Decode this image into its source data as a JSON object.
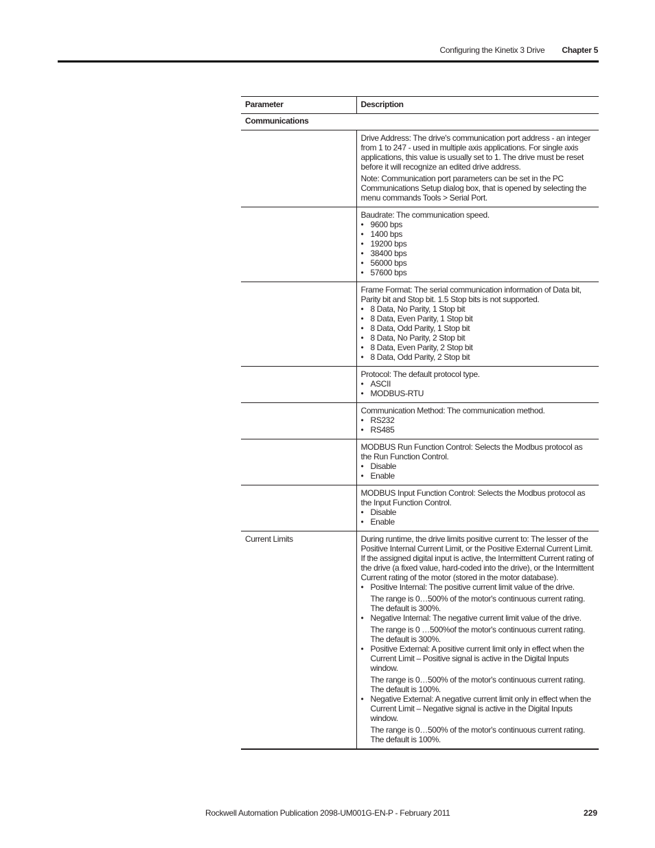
{
  "header": {
    "section_title": "Configuring the Kinetix 3 Drive",
    "chapter": "Chapter 5"
  },
  "table": {
    "columns": [
      "Parameter",
      "Description"
    ],
    "group": "Communications",
    "rows": [
      {
        "parameter": "",
        "paragraphs": [
          "Drive Address: The drive's communication port address - an integer from 1 to 247 - used in multiple axis applications. For single axis applications, this value is usually set to 1. The drive must be reset before it will recognize an edited drive address.",
          "Note: Communication port parameters can be set in the PC Communications Setup dialog box, that is opened by selecting the menu commands Tools > Serial Port."
        ],
        "bullets": []
      },
      {
        "parameter": "",
        "paragraphs": [
          "Baudrate: The communication speed."
        ],
        "bullets": [
          "9600 bps",
          "1400 bps",
          "19200 bps",
          "38400 bps",
          "56000 bps",
          "57600 bps"
        ]
      },
      {
        "parameter": "",
        "paragraphs": [
          "Frame Format: The serial communication information of Data bit, Parity bit and Stop bit. 1.5 Stop bits is not supported."
        ],
        "bullets": [
          "8 Data, No Parity, 1 Stop bit",
          "8 Data, Even Parity, 1 Stop bit",
          "8 Data, Odd Parity, 1 Stop bit",
          "8 Data, No Parity, 2 Stop bit",
          "8 Data, Even Parity, 2 Stop bit",
          "8 Data, Odd Parity, 2 Stop bit"
        ]
      },
      {
        "parameter": "",
        "paragraphs": [
          "Protocol: The default protocol type."
        ],
        "bullets": [
          "ASCII",
          "MODBUS-RTU"
        ]
      },
      {
        "parameter": "",
        "paragraphs": [
          "Communication Method: The communication method."
        ],
        "bullets": [
          "RS232",
          "RS485"
        ]
      },
      {
        "parameter": "",
        "paragraphs": [
          "MODBUS Run Function Control: Selects the Modbus protocol as the Run Function Control."
        ],
        "bullets": [
          "Disable",
          "Enable"
        ]
      },
      {
        "parameter": "",
        "paragraphs": [
          "MODBUS Input Function Control: Selects the Modbus protocol as the Input Function Control."
        ],
        "bullets": [
          "Disable",
          "Enable"
        ]
      }
    ],
    "current_limits": {
      "parameter": "Current Limits",
      "intro": "During runtime, the drive limits positive current to: The lesser of the Positive Internal Current Limit, or the Positive External Current Limit. If the assigned digital input is active, the Intermittent Current rating of the drive (a fixed value, hard-coded into the drive), or the Intermittent Current rating of the motor (stored in the motor database).",
      "items": [
        {
          "text": "Positive Internal: The positive current limit value of the drive.",
          "sub": "The range is 0…500% of the motor's continuous current rating. The default is 300%."
        },
        {
          "text": "Negative Internal: The negative current limit value of the drive.",
          "sub": "The range is 0 …500%of the motor's continuous current rating. The default is 300%."
        },
        {
          "text": "Positive External: A positive current limit only in effect when the Current Limit – Positive signal is active in the Digital Inputs window.",
          "sub": "The range is 0…500% of the motor's continuous current rating. The default is 100%."
        },
        {
          "text": "Negative External: A negative current limit only in effect when the Current Limit – Negative signal is active in the Digital Inputs window.",
          "sub": "The range is 0…500% of the motor's continuous current rating. The default is 100%."
        }
      ]
    }
  },
  "footer": {
    "publication": "Rockwell Automation Publication 2098-UM001G-EN-P  - February 2011",
    "page_number": "229"
  }
}
